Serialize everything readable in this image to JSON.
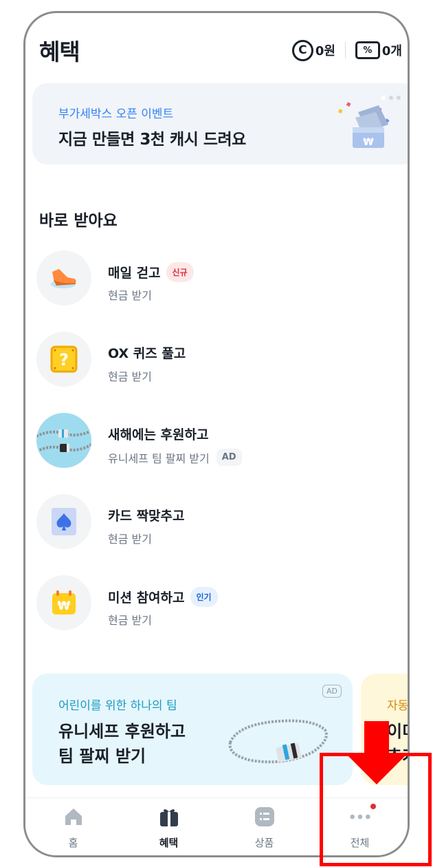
{
  "header": {
    "title": "혜택",
    "cash": "0원",
    "coupons": "0개",
    "cash_icon": "C"
  },
  "banner": {
    "subtitle": "부가세박스 오픈 이벤트",
    "title": "지금 만들면 3천 캐시 드려요",
    "pager_total": 3,
    "pager_active": 1
  },
  "section": {
    "title": "바로 받아요"
  },
  "items": [
    {
      "title": "매일 걷고",
      "desc": "현금 받기",
      "badge": "신규",
      "icon": "sneaker-icon"
    },
    {
      "title": "OX 퀴즈 풀고",
      "desc": "현금 받기",
      "icon": "question-block-icon"
    },
    {
      "title": "새해에는 후원하고",
      "desc": "유니세프 팀 팔찌 받기",
      "ad": "AD",
      "icon": "bracelet-image"
    },
    {
      "title": "카드 짝맞추고",
      "desc": "현금 받기",
      "icon": "spade-card-icon"
    },
    {
      "title": "미션 참여하고",
      "desc": "현금 받기",
      "badge": "인기",
      "icon": "calendar-won-icon"
    }
  ],
  "promo": {
    "subtitle": "어린이를 위한 하나의 팀",
    "line1": "유니세프 후원하고",
    "line2": "팀 팔찌 받기",
    "ad": "AD"
  },
  "promo2": {
    "subtitle": "자동",
    "line1": "이미",
    "line2": "추가"
  },
  "tabs": [
    {
      "label": "홈",
      "icon": "home-icon",
      "active": false
    },
    {
      "label": "혜택",
      "icon": "gift-icon",
      "active": true
    },
    {
      "label": "상품",
      "icon": "products-icon",
      "active": false
    },
    {
      "label": "전체",
      "icon": "more-icon",
      "active": false,
      "notification": true
    }
  ],
  "colors": {
    "accent": "#3182f6",
    "badge_new": "#e42939",
    "badge_hot": "#1b64da",
    "annotation": "#ff0000"
  }
}
